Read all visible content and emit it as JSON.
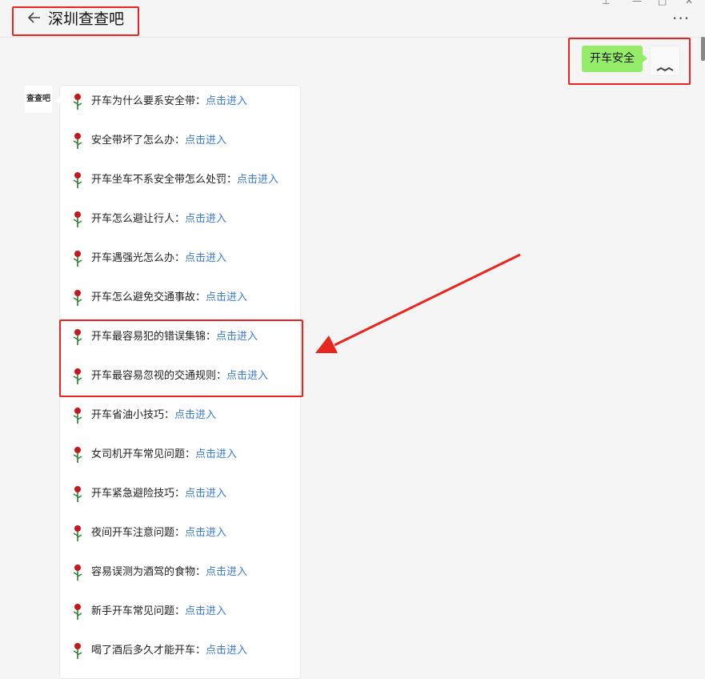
{
  "header": {
    "title": "深圳查查吧"
  },
  "sent_message": {
    "text": "开车安全"
  },
  "bot": {
    "avatar_text": "查查吧"
  },
  "link_label": "点击进入",
  "items": [
    {
      "text": "开车为什么要系安全带：",
      "link": "点击进入"
    },
    {
      "text": "安全带坏了怎么办：",
      "link": "点击进入"
    },
    {
      "text": "开车坐车不系安全带怎么处罚：",
      "link": "点击进入"
    },
    {
      "text": "开车怎么避让行人：",
      "link": "点击进入"
    },
    {
      "text": "开车遇强光怎么办：",
      "link": "点击进入"
    },
    {
      "text": "开车怎么避免交通事故：",
      "link": "点击进入"
    },
    {
      "text": "开车最容易犯的错误集锦：",
      "link": "点击进入"
    },
    {
      "text": "开车最容易忽视的交通规则：",
      "link": "点击进入"
    },
    {
      "text": "开车省油小技巧：",
      "link": "点击进入"
    },
    {
      "text": "女司机开车常见问题：",
      "link": "点击进入"
    },
    {
      "text": "开车紧急避险技巧：",
      "link": "点击进入"
    },
    {
      "text": "夜间开车注意问题：",
      "link": "点击进入"
    },
    {
      "text": "容易误测为酒驾的食物：",
      "link": "点击进入"
    },
    {
      "text": "新手开车常见问题：",
      "link": "点击进入"
    },
    {
      "text": "喝了酒后多久才能开车：",
      "link": "点击进入"
    }
  ],
  "colors": {
    "bubble": "#95ec69",
    "link": "#3a7bd5",
    "highlight": "#e8261f"
  },
  "icons": {
    "back": "arrow-left-icon",
    "more": "more-dots-icon",
    "item": "rose-icon"
  }
}
